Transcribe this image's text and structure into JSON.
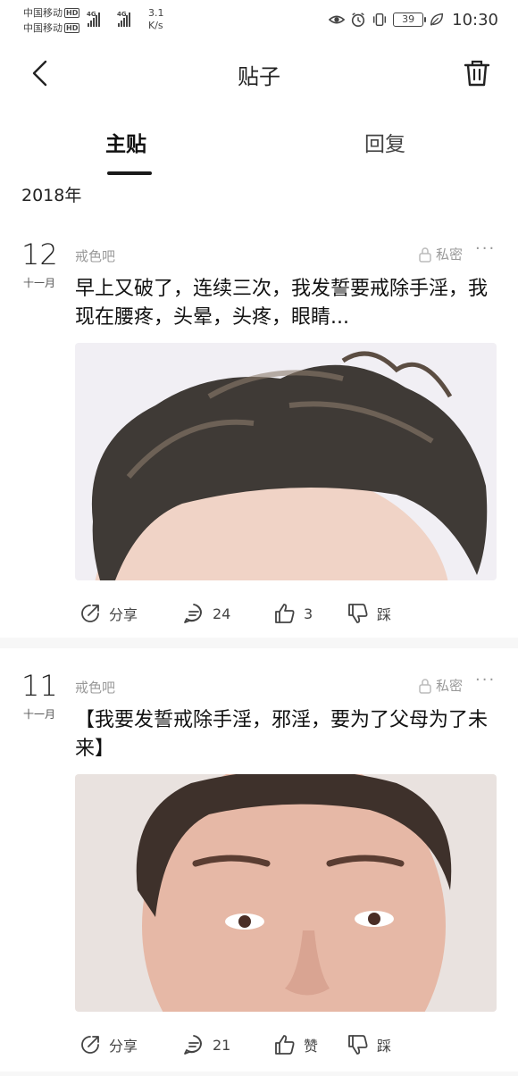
{
  "status_bar": {
    "carrier1": "中国移动",
    "carrier2": "中国移动",
    "hd": "HD",
    "net1": "4G",
    "net2": "4G",
    "speed_value": "3.1",
    "speed_unit": "K/s",
    "battery": "39",
    "time": "10:30"
  },
  "header": {
    "title": "贴子"
  },
  "tabs": [
    {
      "label": "主贴"
    },
    {
      "label": "回复"
    }
  ],
  "year": "2018年",
  "posts": [
    {
      "day": "12",
      "month": "十一月",
      "forum": "戒色吧",
      "privacy": "私密",
      "more": "···",
      "title": "早上又破了，连续三次，我发誓要戒除手淫，我现在腰疼，头晕，头疼，眼睛...",
      "share": "分享",
      "comments": "24",
      "likes": "3",
      "dislike": "踩"
    },
    {
      "day": "11",
      "month": "十一月",
      "forum": "戒色吧",
      "privacy": "私密",
      "more": "···",
      "title": "【我要发誓戒除手淫，邪淫，要为了父母为了未来】",
      "share": "分享",
      "comments": "21",
      "likes": "赞",
      "dislike": "踩"
    }
  ],
  "colors": {
    "text": "#222222",
    "muted": "#999999",
    "divider": "#f7f7f7"
  }
}
